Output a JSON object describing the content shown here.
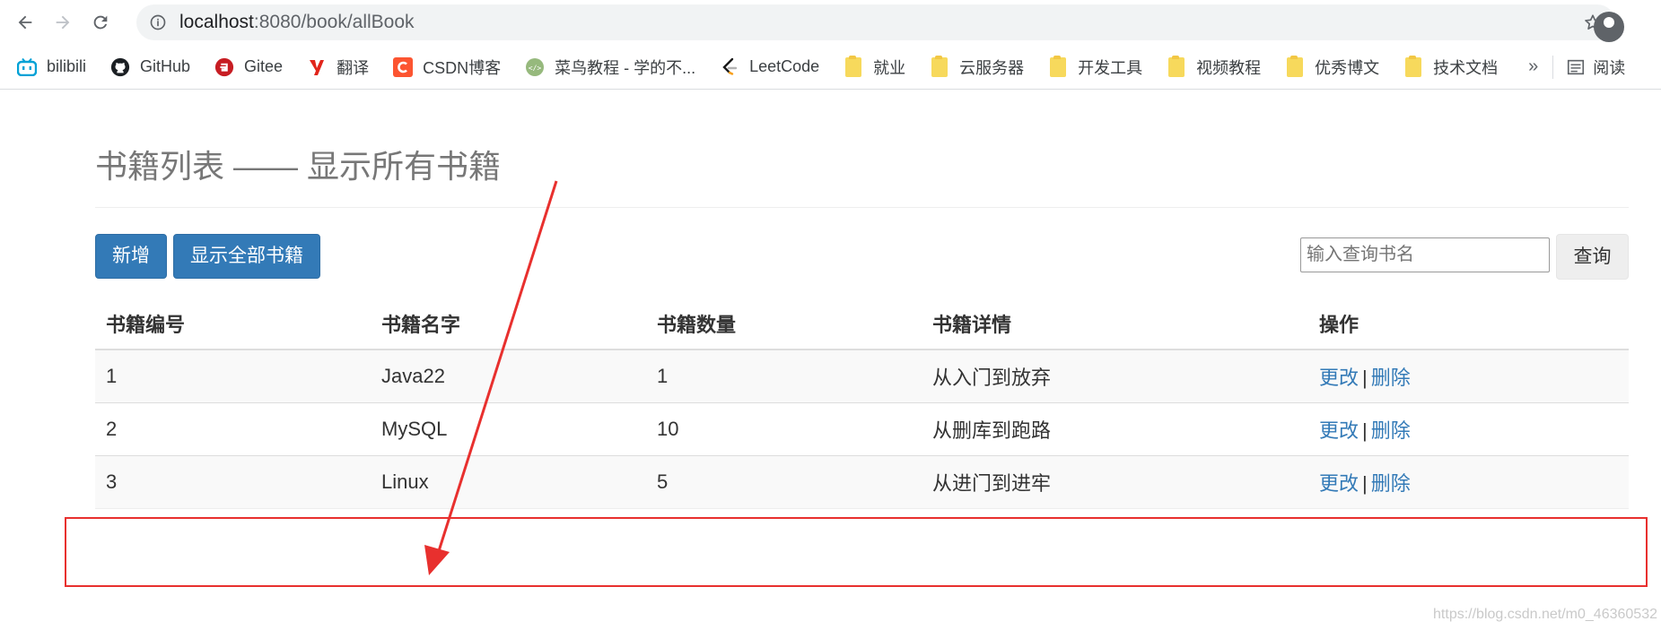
{
  "browser": {
    "url_host": "localhost",
    "url_path": ":8080/book/allBook",
    "bookmarks": [
      {
        "label": "bilibili",
        "icon": "bilibili-icon"
      },
      {
        "label": "GitHub",
        "icon": "github-icon"
      },
      {
        "label": "Gitee",
        "icon": "gitee-icon"
      },
      {
        "label": "翻译",
        "icon": "youdao-icon"
      },
      {
        "label": "CSDN博客",
        "icon": "csdn-icon"
      },
      {
        "label": "菜鸟教程 - 学的不...",
        "icon": "runoob-icon"
      },
      {
        "label": "LeetCode",
        "icon": "leetcode-icon"
      },
      {
        "label": "就业",
        "icon": "folder-icon"
      },
      {
        "label": "云服务器",
        "icon": "folder-icon"
      },
      {
        "label": "开发工具",
        "icon": "folder-icon"
      },
      {
        "label": "视频教程",
        "icon": "folder-icon"
      },
      {
        "label": "优秀博文",
        "icon": "folder-icon"
      },
      {
        "label": "技术文档",
        "icon": "folder-icon"
      }
    ],
    "overflow_label": "»",
    "reading_list_label": "阅读"
  },
  "page": {
    "title": "书籍列表 —— 显示所有书籍",
    "add_button": "新增",
    "show_all_button": "显示全部书籍",
    "search_placeholder": "输入查询书名",
    "query_button": "查询"
  },
  "table": {
    "headers": [
      "书籍编号",
      "书籍名字",
      "书籍数量",
      "书籍详情",
      "操作"
    ],
    "rows": [
      {
        "id": "1",
        "name": "Java22",
        "count": "1",
        "detail": "从入门到放弃"
      },
      {
        "id": "2",
        "name": "MySQL",
        "count": "10",
        "detail": "从删库到跑路"
      },
      {
        "id": "3",
        "name": "Linux",
        "count": "5",
        "detail": "从进门到进牢"
      }
    ],
    "edit_label": "更改",
    "separator": "|",
    "delete_label": "删除"
  },
  "watermark": "https://blog.csdn.net/m0_46360532",
  "colors": {
    "primary": "#337ab7",
    "annotation": "#e8302e"
  }
}
